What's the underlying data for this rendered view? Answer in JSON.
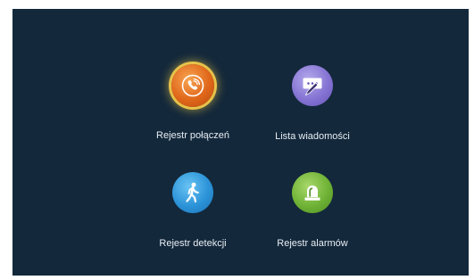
{
  "menu": {
    "items": [
      {
        "label": "Rejestr połączeń",
        "icon": "phone-icon",
        "selected": true,
        "color": "#e0671a"
      },
      {
        "label": "Lista wiadomości",
        "icon": "message-pencil-icon",
        "selected": false,
        "color": "#8574d3"
      },
      {
        "label": "Rejestr detekcji",
        "icon": "walking-person-icon",
        "selected": false,
        "color": "#2c93d8"
      },
      {
        "label": "Rejestr alarmów",
        "icon": "alarm-siren-icon",
        "selected": false,
        "color": "#6fb236"
      }
    ]
  }
}
